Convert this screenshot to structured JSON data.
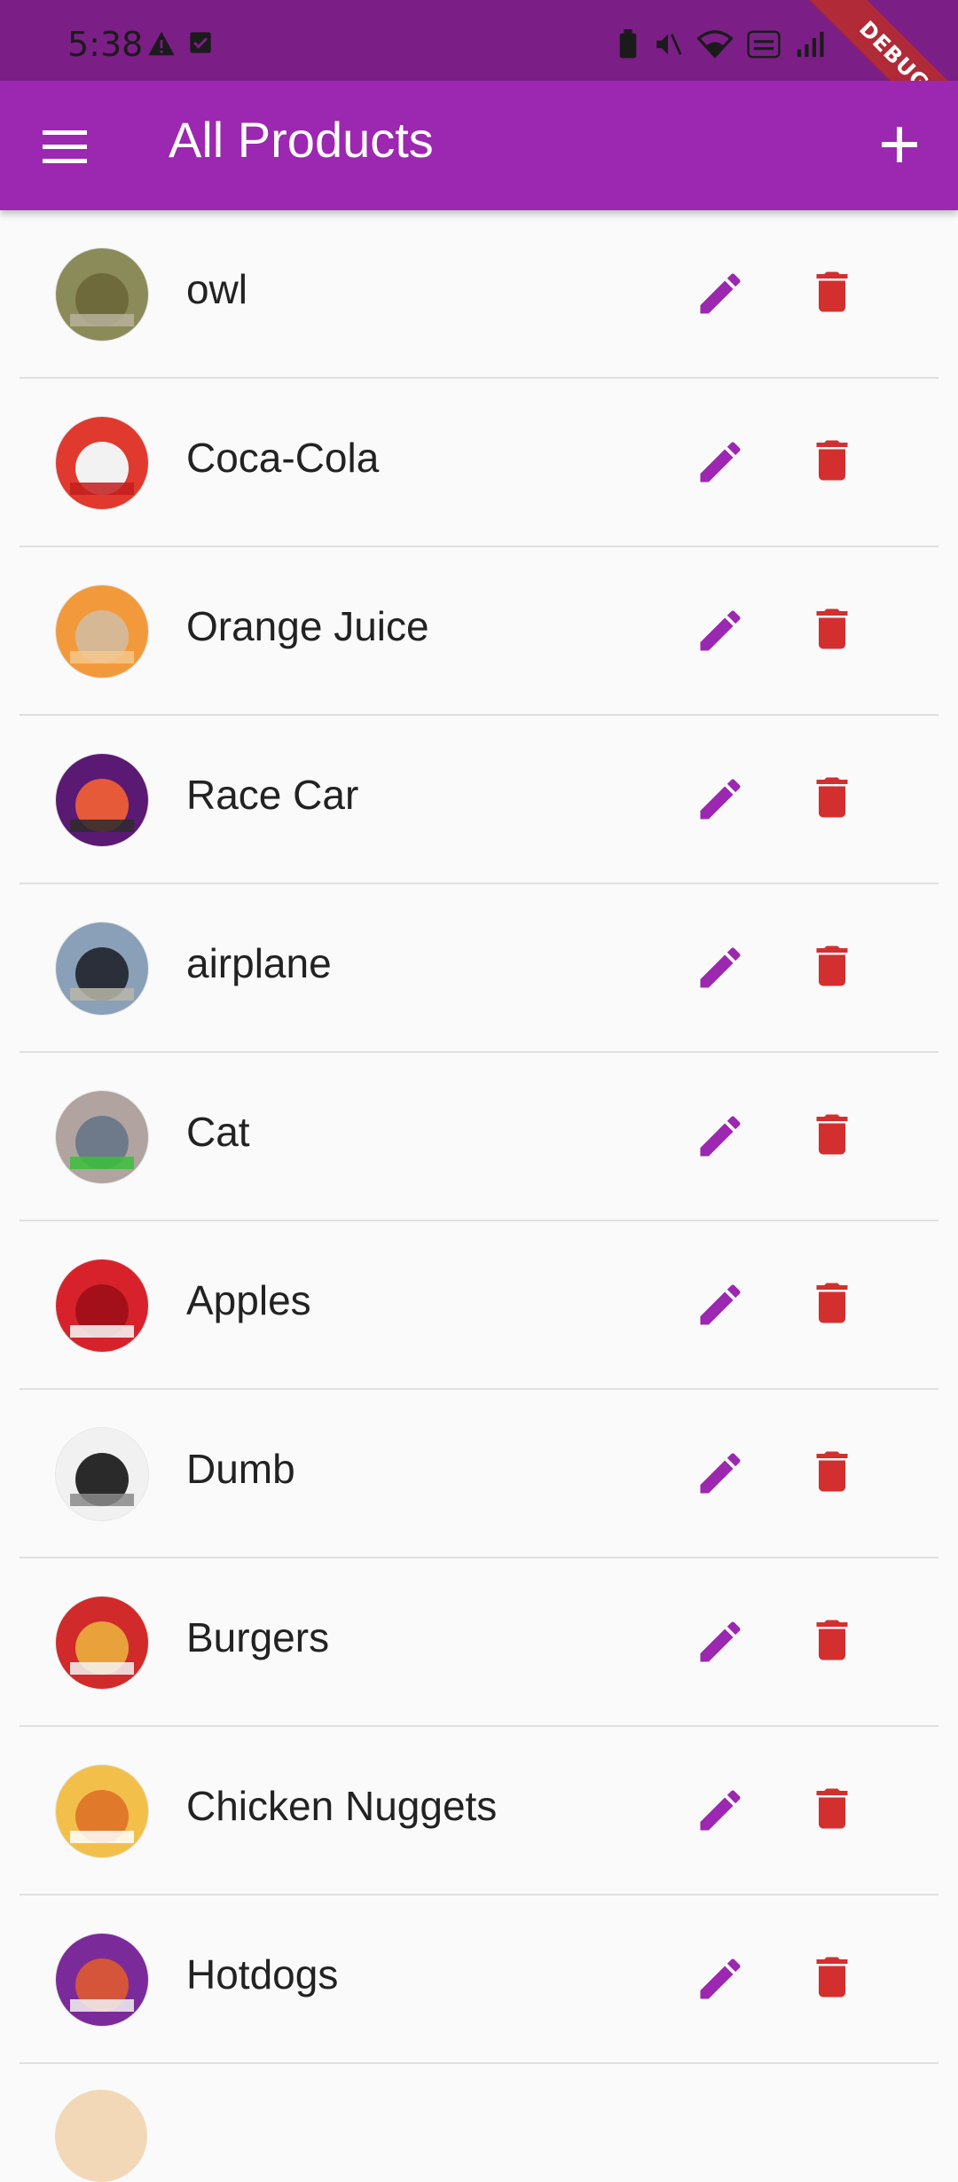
{
  "status": {
    "time": "5:38"
  },
  "debug_label": "DEBUG",
  "app_bar": {
    "title": "All Products",
    "menu_icon": "menu-icon",
    "add_icon": "add-icon"
  },
  "colors": {
    "primary": "#9c27b0",
    "status": "#7b1f86",
    "edit": "#9c27b0",
    "delete": "#d32f2f"
  },
  "products": [
    {
      "name": "owl",
      "thumb": [
        "#8b8b5a",
        "#6f6a3c",
        "#b7b29a"
      ]
    },
    {
      "name": "Coca-Cola",
      "thumb": [
        "#e03a2f",
        "#f2f2f2",
        "#c21d1d"
      ]
    },
    {
      "name": "Orange Juice",
      "thumb": [
        "#f29a3b",
        "#d7b894",
        "#f4c78d"
      ]
    },
    {
      "name": "Race Car",
      "thumb": [
        "#5a1a73",
        "#e65a3a",
        "#2b2b2b"
      ]
    },
    {
      "name": "airplane",
      "thumb": [
        "#8aa0b8",
        "#2a2f3a",
        "#b9b6a8"
      ]
    },
    {
      "name": "Cat",
      "thumb": [
        "#b0a3a0",
        "#6e7a8a",
        "#3bbf3b"
      ]
    },
    {
      "name": "Apples",
      "thumb": [
        "#d8222b",
        "#a3101a",
        "#fafafa"
      ]
    },
    {
      "name": "Dumb",
      "thumb": [
        "#f1f1f1",
        "#2a2a2a",
        "#8a8a8a"
      ]
    },
    {
      "name": "Burgers",
      "thumb": [
        "#d02a2a",
        "#e9a23b",
        "#f4f4f4"
      ]
    },
    {
      "name": "Chicken Nuggets",
      "thumb": [
        "#f2c04a",
        "#e07a2a",
        "#ffffff"
      ]
    },
    {
      "name": "Hotdogs",
      "thumb": [
        "#7b2a9a",
        "#d4553a",
        "#f2f2f2"
      ]
    }
  ]
}
